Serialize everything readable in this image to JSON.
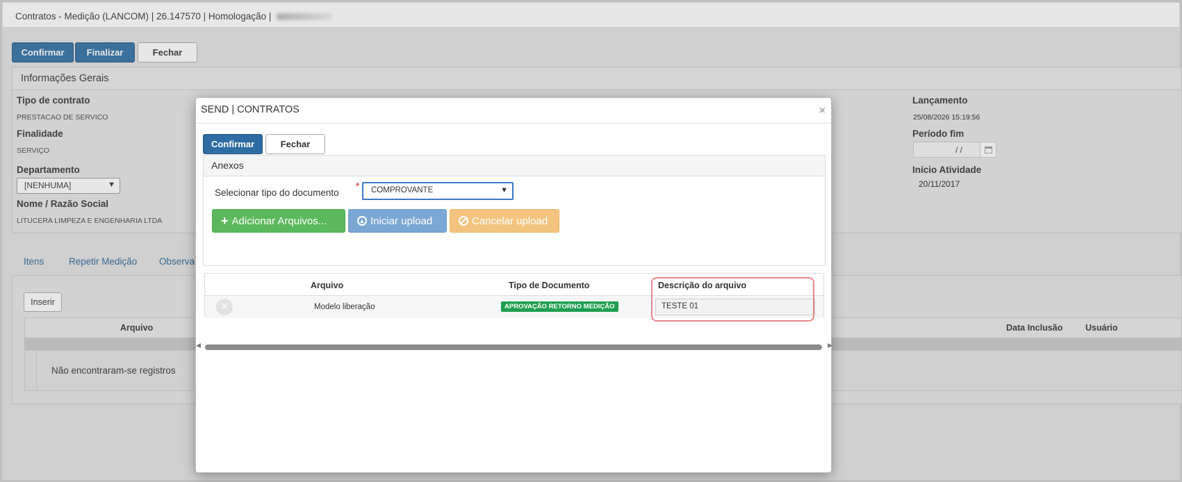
{
  "window": {
    "title": "Contratos - Medição (LANCOM) | 26.147570 | Homologação |"
  },
  "toolbar": {
    "confirm_label": "Confirmar",
    "finalize_label": "Finalizar",
    "close_label": "Fechar"
  },
  "general_info": {
    "heading": "Informações Gerais",
    "contract_type_label": "Tipo de contrato",
    "contract_type_value": "PRESTACAO DE SERVICO",
    "purpose_label": "Finalidade",
    "purpose_value": "SERVIÇO",
    "department_label": "Departamento",
    "department_value": "[NENHUMA]",
    "name_label": "Nome / Razão Social",
    "name_value": "LITUCERA LIMPEZA E ENGENHARIA LTDA",
    "launch_label": "Lançamento",
    "launch_value": "25/08/2026 15:19:56",
    "period_end_label": "Período fim",
    "period_end_value": "/ /",
    "activity_start_label": "Início Atividade",
    "activity_start_value": "20/11/2017"
  },
  "tabs": [
    {
      "label": "Itens"
    },
    {
      "label": "Repetir Medição"
    },
    {
      "label": "Observaç"
    }
  ],
  "files_section": {
    "insert_label": "Inserir",
    "col_file": "Arquivo",
    "col_date": "Data Inclusão",
    "col_user": "Usuário",
    "empty_message": "Não encontraram-se registros"
  },
  "modal": {
    "title": "SEND | CONTRATOS",
    "close_symbol": "×",
    "confirm_label": "Confirmar",
    "close_label": "Fechar",
    "attachments_heading": "Anexos",
    "doc_type_label": "Selecionar tipo do documento",
    "required_mark": "*",
    "doc_type_value": "COMPROVANTE",
    "add_files_label": "Adicionar Arquivos...",
    "start_upload_label": "Iniciar upload",
    "cancel_upload_label": "Cancelar upload",
    "table": {
      "col_file": "Arquivo",
      "col_doc_type": "Tipo de Documento",
      "col_description": "Descrição do arquivo",
      "rows": [
        {
          "file": "Modelo liberação",
          "doc_type": "APROVAÇÃO RETORNO MEDIÇÃO",
          "description": "TESTE 01"
        }
      ]
    }
  },
  "colors": {
    "primary": "#2e6da4",
    "success": "#5cb85c",
    "info": "#7aa7d4",
    "warning": "#f3c47f",
    "badge_green": "#1e9e50",
    "highlight": "#e8878a"
  }
}
